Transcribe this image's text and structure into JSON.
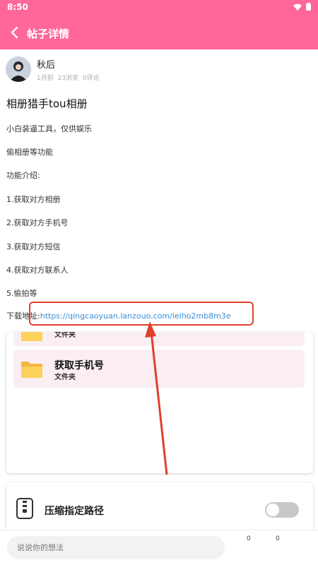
{
  "status_bar": {
    "time": "8:50"
  },
  "header": {
    "title": "帖子详情"
  },
  "author": {
    "name": "秋后",
    "time": "1月前",
    "views": "23浏览",
    "comments": "0评论"
  },
  "post": {
    "title": "相册猎手tou相册",
    "lines": [
      "小白装逼工具，仅供娱乐",
      "偷相册等功能",
      "功能介绍:",
      "1.获取对方相册",
      "2.获取对方手机号",
      "3.获取对方短信",
      "4.获取对方联系人",
      "5.偷拍等"
    ],
    "download_label": "下载地址:",
    "download_url": "https://qingcaoyuan.lanzouo.com/ielho2mb8m3e"
  },
  "folders": [
    {
      "name": "",
      "sub": "文件夹"
    },
    {
      "name": "获取手机号",
      "sub": "文件夹"
    }
  ],
  "compress": {
    "label": "压缩指定路径"
  },
  "comment_bar": {
    "placeholder": "说说你的想法",
    "count_a": "0",
    "count_b": "0"
  },
  "colors": {
    "brand": "#ff6699",
    "annotation": "#e0402a",
    "link": "#3a8fd9"
  }
}
